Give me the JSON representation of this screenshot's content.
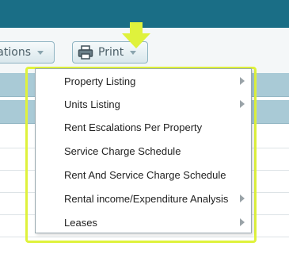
{
  "toolbar": {
    "escalations_label": "ations",
    "print_label": "Print"
  },
  "menu": {
    "items": [
      {
        "label": "Property Listing",
        "has_submenu": true
      },
      {
        "label": "Units Listing",
        "has_submenu": true
      },
      {
        "label": "Rent Escalations Per Property",
        "has_submenu": false
      },
      {
        "label": "Service Charge Schedule",
        "has_submenu": false
      },
      {
        "label": "Rent And Service Charge Schedule",
        "has_submenu": false
      },
      {
        "label": "Rental income/Expenditure Analysis",
        "has_submenu": true
      },
      {
        "label": "Leases",
        "has_submenu": true
      }
    ]
  },
  "colors": {
    "topbar": "#1a6e86",
    "highlight": "#dff23c",
    "header_row": "#a9cad6"
  },
  "icons": [
    "printer-icon",
    "chevron-down-icon",
    "chevron-right-icon",
    "pointer-arrow-icon"
  ]
}
